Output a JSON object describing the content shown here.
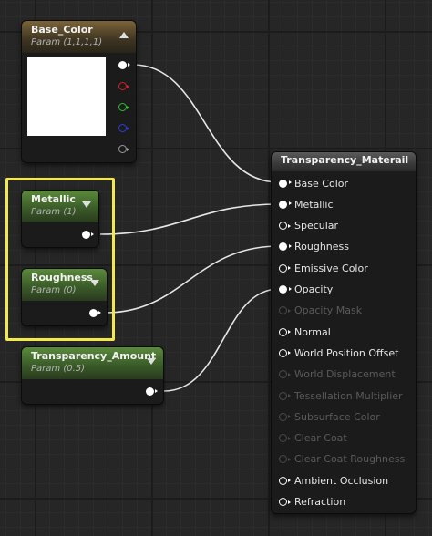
{
  "colors": {
    "wire": "#e6e6e6",
    "selection": "#f4e94c",
    "pin_white": "#ffffff",
    "pin_red": "#d42020",
    "pin_green": "#2fbf2f",
    "pin_blue": "#2a3fd0",
    "pin_alpha": "#9a9a9a",
    "param_header": "#5b8a3c",
    "vector_header": "#7a6338"
  },
  "nodes": {
    "base_color": {
      "title": "Base_Color",
      "subtitle": "Param (1,1,1,1)",
      "toggle_icon": "collapse-up-icon"
    },
    "metallic": {
      "title": "Metallic",
      "subtitle": "Param (1)",
      "toggle_icon": "expand-down-icon"
    },
    "roughness": {
      "title": "Roughness",
      "subtitle": "Param (0)",
      "toggle_icon": "expand-down-icon"
    },
    "transparency_amount": {
      "title": "Transparency_Amount",
      "subtitle": "Param (0.5)",
      "toggle_icon": "expand-down-icon"
    },
    "material": {
      "title": "Transparency_Materail",
      "inputs": [
        {
          "label": "Base Color",
          "connected": true,
          "enabled": true
        },
        {
          "label": "Metallic",
          "connected": true,
          "enabled": true
        },
        {
          "label": "Specular",
          "connected": false,
          "enabled": true
        },
        {
          "label": "Roughness",
          "connected": true,
          "enabled": true
        },
        {
          "label": "Emissive Color",
          "connected": false,
          "enabled": true
        },
        {
          "label": "Opacity",
          "connected": true,
          "enabled": true
        },
        {
          "label": "Opacity Mask",
          "connected": false,
          "enabled": false
        },
        {
          "label": "Normal",
          "connected": false,
          "enabled": true
        },
        {
          "label": "World Position Offset",
          "connected": false,
          "enabled": true
        },
        {
          "label": "World Displacement",
          "connected": false,
          "enabled": false
        },
        {
          "label": "Tessellation Multiplier",
          "connected": false,
          "enabled": false
        },
        {
          "label": "Subsurface Color",
          "connected": false,
          "enabled": false
        },
        {
          "label": "Clear Coat",
          "connected": false,
          "enabled": false
        },
        {
          "label": "Clear Coat Roughness",
          "connected": false,
          "enabled": false
        },
        {
          "label": "Ambient Occlusion",
          "connected": false,
          "enabled": true
        },
        {
          "label": "Refraction",
          "connected": false,
          "enabled": true
        }
      ]
    }
  },
  "wires": [
    {
      "from": "base_color.rgba",
      "to": "material.Base Color"
    },
    {
      "from": "metallic.out",
      "to": "material.Metallic"
    },
    {
      "from": "roughness.out",
      "to": "material.Roughness"
    },
    {
      "from": "transparency_amount.out",
      "to": "material.Opacity"
    }
  ]
}
